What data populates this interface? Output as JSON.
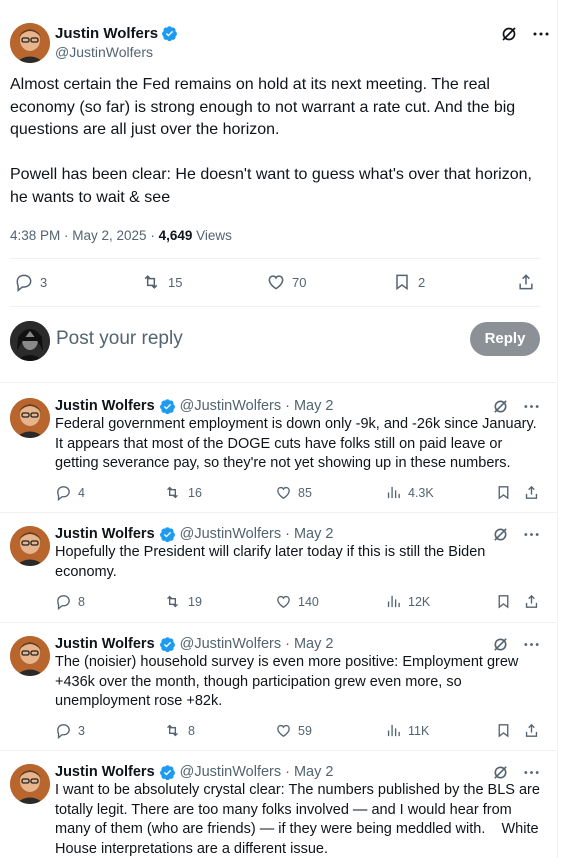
{
  "main_tweet": {
    "author_name": "Justin Wolfers",
    "handle": "@JustinWolfers",
    "text": "Almost certain the Fed remains on hold at its next meeting. The real economy (so far) is strong enough to not warrant a rate cut. And the big questions are all just over the horizon.\n\nPowell has been clear: He doesn't want to guess what's over that horizon, he wants to wait & see",
    "time": "4:38 PM · May 2, 2025 · ",
    "views_count": "4,649",
    "views_label": " Views",
    "replies": "3",
    "reposts": "15",
    "likes": "70",
    "bookmarks": "2"
  },
  "reply_box": {
    "placeholder": "Post your reply",
    "button": "Reply"
  },
  "replies": [
    {
      "name": "Justin Wolfers",
      "handle": "@JustinWolfers",
      "date": "· May 2",
      "text": "Federal government employment is down only -9k, and -26k since January.\nIt appears that most of the DOGE cuts have folks still on paid leave or\ngetting severance pay, so they're not yet showing up in these numbers.",
      "replies": "4",
      "reposts": "16",
      "likes": "85",
      "views": "4.3K"
    },
    {
      "name": "Justin Wolfers",
      "handle": "@JustinWolfers",
      "date": "· May 2",
      "text": "Hopefully the President will clarify later today if this is still the Biden\neconomy.",
      "replies": "8",
      "reposts": "19",
      "likes": "140",
      "views": "12K"
    },
    {
      "name": "Justin Wolfers",
      "handle": "@JustinWolfers",
      "date": "· May 2",
      "text": "The (noisier) household survey is even more positive: Employment grew\n+436k over the month, though participation grew even more, so\nunemployment rose +82k.",
      "replies": "3",
      "reposts": "8",
      "likes": "59",
      "views": "11K"
    },
    {
      "name": "Justin Wolfers",
      "handle": "@JustinWolfers",
      "date": "· May 2",
      "text": "I want to be absolutely crystal clear: The numbers published by the BLS are\ntotally legit. There are too many folks involved — and I would hear from\nmany of them (who are friends) — if they were being meddled with.    White\nHouse interpretations are a different issue."
    }
  ],
  "colors": {
    "text_primary": "#0f1419",
    "text_secondary": "#536471",
    "verified_blue": "#1d9bf0",
    "reply_button": "#8b9196",
    "divider": "#eff3f4"
  },
  "icons": [
    "verified-icon",
    "grok-icon",
    "more-icon",
    "reply-icon",
    "repost-icon",
    "like-icon",
    "bookmark-icon",
    "share-icon",
    "views-icon"
  ]
}
